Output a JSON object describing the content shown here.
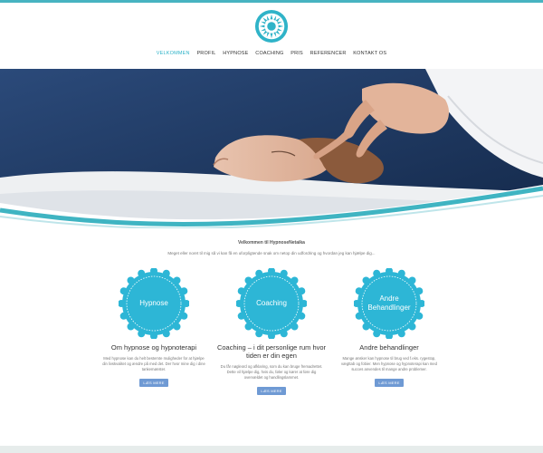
{
  "nav": {
    "items": [
      "VELKOMMEN",
      "PROFIL",
      "HYPNOSE",
      "COACHING",
      "PRIS",
      "REFERENCER",
      "KONTAKT OS"
    ]
  },
  "welcome": {
    "title": "Velkommen til HypnoseNetaika",
    "text": "Meget eller noret til mig så vi kan få en uforpligtende snak om netop din udfordring og hvordan jeg kan hjælpe dig..."
  },
  "cards": [
    {
      "badge": "Hypnose",
      "title": "Om hypnose og hypnoterapi",
      "text": "Med hypnose kan du helt bestemte muligheder for at hjælpe din livskvalitet og ændre på med det. Der hvor mine dig i dine tankemønster.",
      "button": "LÆS MERE"
    },
    {
      "badge": "Coaching",
      "title": "Coaching – i dit personlige rum hvor tiden er din egen",
      "text": "Du får nøgleord og afklaring, som du kan bruge fremadrettet. Dette vil hjælpe dig, hvis du, føler og kører at føre dig overvældet og handlingslammet.",
      "button": "LÆS MERE"
    },
    {
      "badge": "Andre Behandlinger",
      "title": "Andre behandlinger",
      "text": "Mange ønsker kan hypnose til brug ved f.eks. rygestop, vægttab og fobier. Men hypnose og hypnoterapi kan med succes anvendes til mange andre problemer.",
      "button": "LÆS MERE"
    }
  ],
  "colors": {
    "accent": "#2fb3c8",
    "badge": "#2db6d6",
    "button": "#6f9ad4",
    "hero_bg": "#1f3a63"
  }
}
